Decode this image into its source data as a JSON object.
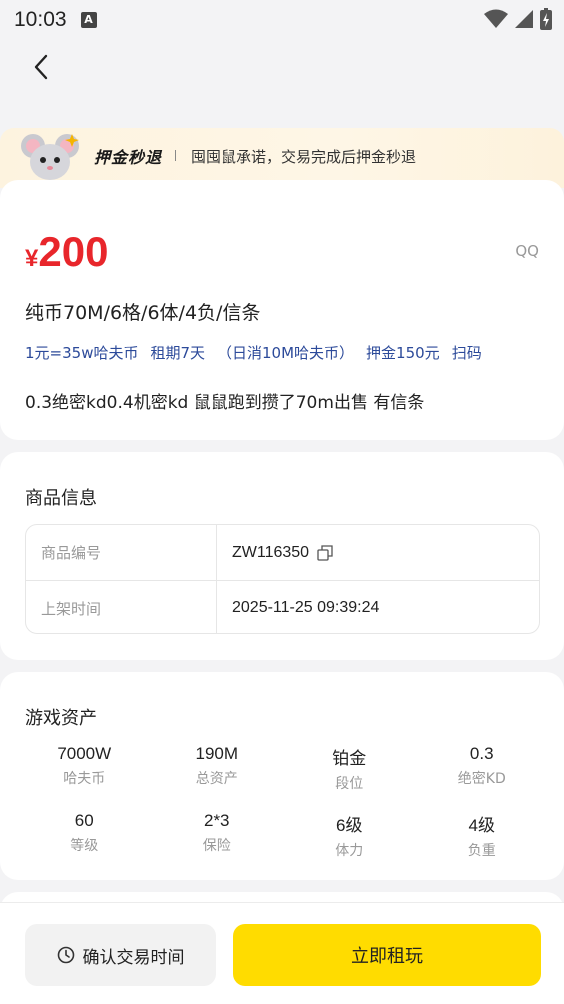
{
  "status_bar": {
    "time": "10:03",
    "icons": [
      "app-notification-icon",
      "wifi-icon",
      "cellular-signal-icon",
      "battery-charging-icon"
    ]
  },
  "nav": {
    "back_icon": "chevron-left-icon"
  },
  "banner": {
    "mascot_icon": "mouse-mascot-icon",
    "title": "押金秒退",
    "description": "囤囤鼠承诺，交易完成后押金秒退"
  },
  "listing": {
    "currency_symbol": "¥",
    "price": "200",
    "platform": "QQ",
    "title": "纯币70M/6格/6体/4负/信条",
    "tags": [
      "1元=35w哈夫币",
      "租期7天",
      "（日消10M哈夫币）",
      "押金150元",
      "扫码"
    ],
    "description": "0.3绝密kd0.4机密kd 鼠鼠跑到攒了70m出售 有信条"
  },
  "product_info": {
    "section_title": "商品信息",
    "rows": [
      {
        "label": "商品编号",
        "value": "ZW116350"
      },
      {
        "label": "上架时间",
        "value": "2025-11-25 09:39:24"
      }
    ]
  },
  "game_assets": {
    "section_title": "游戏资产",
    "items": [
      {
        "value": "7000W",
        "label": "哈夫币"
      },
      {
        "value": "190M",
        "label": "总资产"
      },
      {
        "value": "铂金",
        "label": "段位"
      },
      {
        "value": "0.3",
        "label": "绝密KD"
      },
      {
        "value": "60",
        "label": "等级"
      },
      {
        "value": "2*3",
        "label": "保险"
      },
      {
        "value": "6级",
        "label": "体力"
      },
      {
        "value": "4级",
        "label": "负重"
      }
    ]
  },
  "actions": {
    "confirm_time_label": "确认交易时间",
    "rent_now_label": "立即租玩"
  },
  "colors": {
    "price": "#e8262b",
    "tag_text": "#2c4a9a",
    "primary_button": "#ffdc00",
    "banner_bg": "#fdf3df",
    "page_bg": "#f3f3f5"
  }
}
